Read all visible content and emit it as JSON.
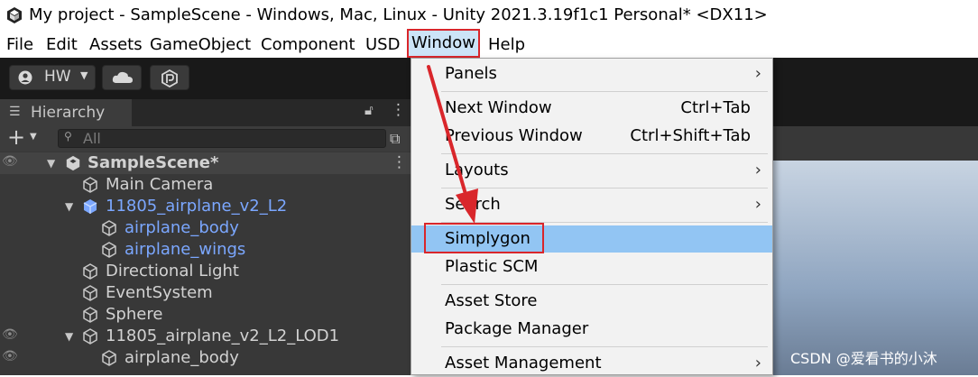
{
  "title_bar": {
    "title": "My project - SampleScene - Windows, Mac, Linux - Unity 2021.3.19f1c1 Personal* <DX11>"
  },
  "menubar": {
    "items": [
      "File",
      "Edit",
      "Assets",
      "GameObject",
      "Component",
      "USD",
      "Window",
      "Help"
    ]
  },
  "toolbar": {
    "account_label": "HW"
  },
  "hierarchy": {
    "tab_label": "Hierarchy",
    "search_placeholder": "All",
    "scene_name": "SampleScene*",
    "rows": [
      {
        "label": "Main Camera"
      },
      {
        "label": "11805_airplane_v2_L2"
      },
      {
        "label": "airplane_body"
      },
      {
        "label": "airplane_wings"
      },
      {
        "label": "Directional Light"
      },
      {
        "label": "EventSystem"
      },
      {
        "label": "Sphere"
      },
      {
        "label": "11805_airplane_v2_L2_LOD1"
      },
      {
        "label": "airplane_body"
      }
    ]
  },
  "window_menu": {
    "items": [
      {
        "label": "Panels",
        "submenu": true
      },
      {
        "label": "Next Window",
        "shortcut": "Ctrl+Tab"
      },
      {
        "label": "Previous Window",
        "shortcut": "Ctrl+Shift+Tab"
      },
      {
        "label": "Layouts",
        "submenu": true
      },
      {
        "label": "Search",
        "submenu": true
      },
      {
        "label": "Simplygon",
        "highlighted": true
      },
      {
        "label": "Plastic SCM"
      },
      {
        "label": "Asset Store"
      },
      {
        "label": "Package Manager"
      },
      {
        "label": "Asset Management",
        "submenu": true
      }
    ]
  },
  "watermark": "CSDN @爱看书的小沐",
  "colors": {
    "highlight": "#92c5f3",
    "annotation_red": "#d9262b",
    "prefab_blue": "#7ba7ff"
  }
}
